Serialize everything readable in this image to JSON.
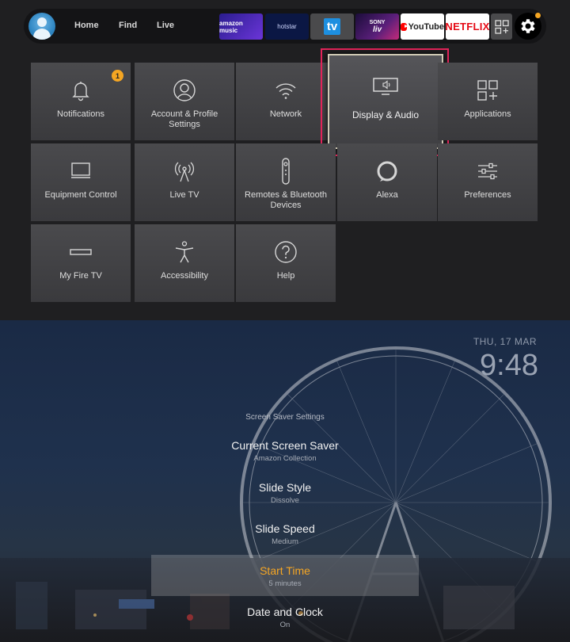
{
  "topbar": {
    "nav": [
      "Home",
      "Find",
      "Live"
    ],
    "apps": {
      "amazon_music": "amazon music",
      "hotstar": "hotstar",
      "tv": "tv",
      "sony_top": "SONY",
      "sony_bottom": "liv",
      "youtube": "YouTube",
      "netflix": "NETFLIX"
    },
    "accent_notification": "#f5a623"
  },
  "settings": {
    "tiles": [
      {
        "label": "Notifications",
        "icon": "bell-icon",
        "badge": "1"
      },
      {
        "label": "Account & Profile Settings",
        "icon": "user-circle-icon"
      },
      {
        "label": "Network",
        "icon": "wifi-icon"
      },
      {
        "label": "Display & Audio",
        "icon": "display-audio-icon",
        "focused": true
      },
      {
        "label": "Applications",
        "icon": "apps-grid-icon"
      },
      {
        "label": "Equipment Control",
        "icon": "monitor-icon"
      },
      {
        "label": "Live TV",
        "icon": "antenna-icon"
      },
      {
        "label": "Remotes & Bluetooth Devices",
        "icon": "remote-icon"
      },
      {
        "label": "Alexa",
        "icon": "alexa-ring-icon"
      },
      {
        "label": "Preferences",
        "icon": "sliders-icon"
      },
      {
        "label": "My Fire TV",
        "icon": "fire-tv-stick-icon"
      },
      {
        "label": "Accessibility",
        "icon": "accessibility-icon"
      },
      {
        "label": "Help",
        "icon": "help-icon"
      }
    ],
    "focus_color": "#e4245a"
  },
  "screensaver": {
    "date": "THU, 17 MAR",
    "time": "9:48",
    "title": "Screen Saver Settings",
    "items": [
      {
        "label": "Current Screen Saver",
        "value": "Amazon Collection"
      },
      {
        "label": "Slide Style",
        "value": "Dissolve"
      },
      {
        "label": "Slide Speed",
        "value": "Medium"
      },
      {
        "label": "Start Time",
        "value": "5 minutes",
        "selected": true
      },
      {
        "label": "Date and Clock",
        "value": "On"
      }
    ],
    "selected_color": "#f5a623"
  }
}
